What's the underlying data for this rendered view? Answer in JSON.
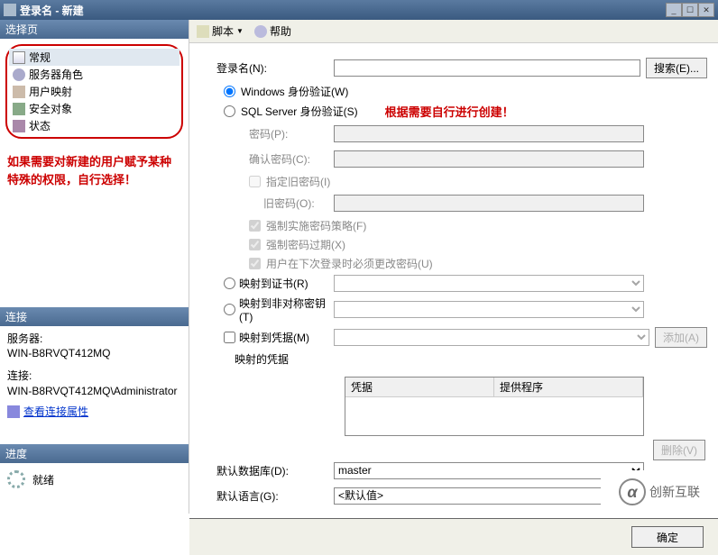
{
  "window": {
    "title": "登录名 - 新建"
  },
  "win_controls": {
    "min": "_",
    "max": "☐",
    "close": "✕"
  },
  "sidebar": {
    "select_header": "选择页",
    "items": [
      {
        "label": "常规",
        "icon": "page"
      },
      {
        "label": "服务器角色",
        "icon": "gear"
      },
      {
        "label": "用户映射",
        "icon": "user"
      },
      {
        "label": "安全对象",
        "icon": "lock"
      },
      {
        "label": "状态",
        "icon": "state"
      }
    ],
    "note": "如果需要对新建的用户赋予某种特殊的权限，自行选择！",
    "conn_header": "连接",
    "server_label": "服务器:",
    "server_value": "WIN-B8RVQT412MQ",
    "conn_label": "连接:",
    "conn_value": "WIN-B8RVQT412MQ\\Administrator",
    "view_conn": "查看连接属性",
    "progress_header": "进度",
    "progress_status": "就绪"
  },
  "toolbar": {
    "script": "脚本",
    "help": "帮助"
  },
  "form": {
    "login_name": "登录名(N):",
    "search_btn": "搜索(E)...",
    "auth_windows": "Windows 身份验证(W)",
    "auth_sql": "SQL Server 身份验证(S)",
    "red_note": "根据需要自行进行创建！",
    "password": "密码(P):",
    "confirm_password": "确认密码(C):",
    "specify_old": "指定旧密码(I)",
    "old_password": "旧密码(O):",
    "enforce_policy": "强制实施密码策略(F)",
    "enforce_expiry": "强制密码过期(X)",
    "must_change": "用户在下次登录时必须更改密码(U)",
    "map_cert": "映射到证书(R)",
    "map_asym": "映射到非对称密钥(T)",
    "map_cred": "映射到凭据(M)",
    "add_btn": "添加(A)",
    "mapped_creds": "映射的凭据",
    "col_cred": "凭据",
    "col_provider": "提供程序",
    "delete_btn": "删除(V)",
    "default_db": "默认数据库(D):",
    "default_db_value": "master",
    "default_lang": "默认语言(G):",
    "default_lang_value": "<默认值>"
  },
  "buttons": {
    "ok": "确定"
  },
  "watermark": {
    "text": "创新互联"
  }
}
